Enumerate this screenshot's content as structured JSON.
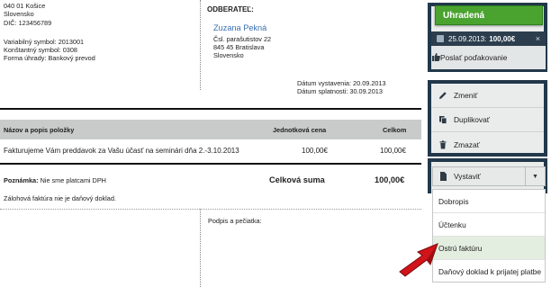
{
  "supplier": {
    "address_line": "040 01 Košice",
    "country": "Slovensko",
    "dic": "DIČ: 123456789"
  },
  "payment": {
    "variable_symbol": "Variabilný symbol: 2013001",
    "constant_symbol": "Konštantný symbol: 0308",
    "method": "Forma úhrady: Bankový prevod"
  },
  "customer": {
    "heading": "ODBERATEĽ:",
    "name": "Zuzana Pekná",
    "street": "Čsl. parašutistov 22",
    "city": "845 45 Bratislava",
    "country": "Slovensko"
  },
  "dates": {
    "issued": "Dátum vystavenia: 20.09.2013",
    "due": "Dátum splatnosti: 30.09.2013"
  },
  "table": {
    "headers": [
      "Názov a popis položky",
      "Jednotková cena",
      "Celkom"
    ],
    "rows": [
      [
        "Fakturujeme Vám preddavok za Vašu účasť na seminári dňa 2.-3.10.2013",
        "100,00€",
        "100,00€"
      ]
    ]
  },
  "notes": {
    "label": "Poznámka:",
    "text": "Nie sme platcami DPH",
    "advance_note": "Zálohová faktúra nie je daňový doklad."
  },
  "totals": {
    "label": "Celková suma",
    "value": "100,00€"
  },
  "signature_label": "Podpis a pečiatka:",
  "panel": {
    "status": "Uhradená",
    "paid_date": "25.09.2013:",
    "paid_amount": "100,00€",
    "close_glyph": "×",
    "thanks": "Poslať poďakovanie",
    "actions": [
      "Zmeniť",
      "Duplikovať",
      "Zmazať"
    ],
    "issue_button": "Vystaviť",
    "issue_options": [
      "Dobropis",
      "Účtenku",
      "Ostrú faktúru",
      "Daňový doklad k prijatej platbe"
    ],
    "highlighted_option": "Ostrú faktúru"
  },
  "colors": {
    "status_green": "#4aa32f",
    "panel_dark": "#22384a",
    "pointer_red": "#d1141a",
    "link_blue": "#3a6fb0"
  },
  "icons": [
    "calendar-icon",
    "thumbs-up-icon",
    "pencil-icon",
    "copy-icon",
    "trash-icon",
    "file-icon",
    "chevron-down-icon",
    "pointer-arrow-icon"
  ]
}
